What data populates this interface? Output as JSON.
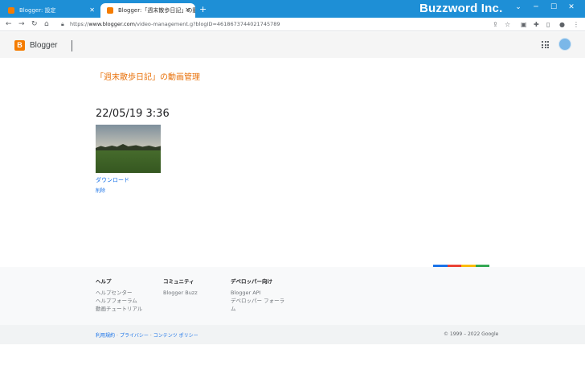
{
  "browser": {
    "tabs": [
      {
        "title": "Blogger: 設定"
      },
      {
        "title": "Blogger:「週末散歩日記」の動画管理"
      }
    ],
    "new_tab": "+",
    "brand": "Buzzword Inc.",
    "url_prefix": "https://",
    "url_host": "www.blogger.com",
    "url_path": "/video-management.g?blogID=4618673744021745789"
  },
  "header": {
    "logo_letter": "B",
    "app_name": "Blogger"
  },
  "main": {
    "page_title": "「週末散歩日記」の動画管理",
    "video": {
      "date": "22/05/19 3:36",
      "download_label": "ダウンロード",
      "delete_label": "削除"
    }
  },
  "footer": {
    "columns": [
      {
        "heading": "ヘルプ",
        "items": [
          "ヘルプセンター",
          "ヘルプフォーラム",
          "動画チュートリアル"
        ]
      },
      {
        "heading": "コミュニティ",
        "items": [
          "Blogger Buzz"
        ]
      },
      {
        "heading": "デベロッパー向け",
        "items": [
          "Blogger API",
          "デベロッパー フォーラ",
          "ム"
        ]
      }
    ],
    "legal_links": [
      "利用規約",
      "プライバシー",
      "コンテンツ ポリシー"
    ],
    "copyright": "© 1999 – 2022 Google"
  },
  "colors": {
    "accent": "#e8710a",
    "link": "#1a73e8",
    "tab_strip": "#1e8fd6",
    "google_bar": [
      "#1a73e8",
      "#ea4335",
      "#fbbc04",
      "#34a853"
    ]
  },
  "icons": [
    "back-arrow-icon",
    "forward-arrow-icon",
    "reload-icon",
    "home-icon",
    "lock-icon",
    "share-icon",
    "star-icon",
    "extensions-icon",
    "sidebar-icon",
    "profile-icon",
    "menu-dots-icon",
    "apps-grid-icon"
  ]
}
